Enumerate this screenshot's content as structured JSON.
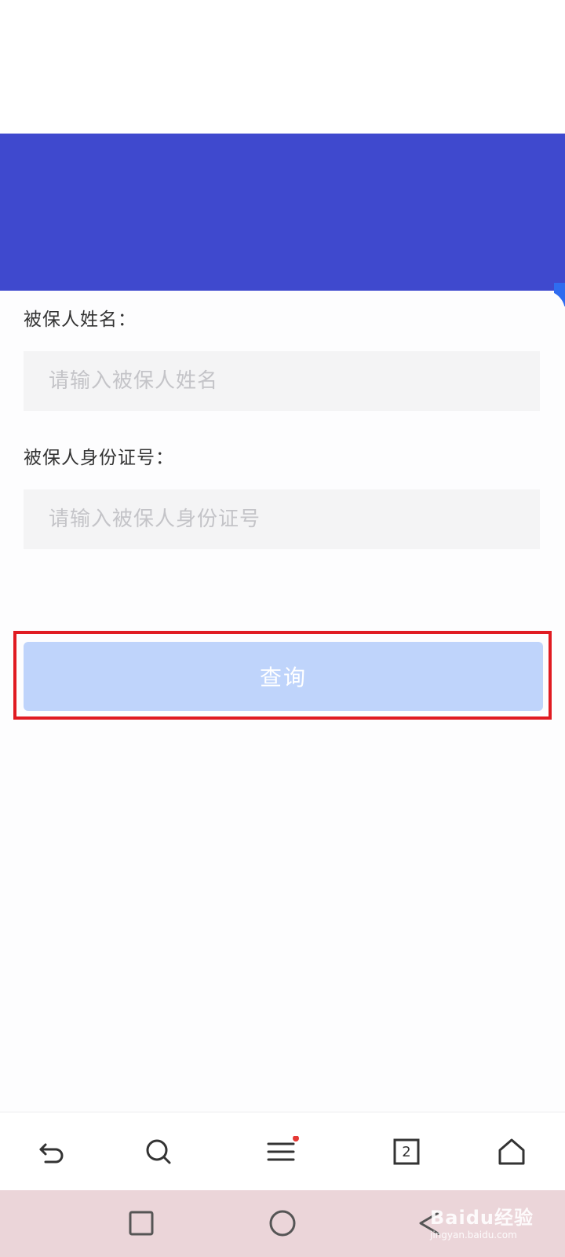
{
  "form": {
    "name_label": "被保人姓名：",
    "name_placeholder": "请输入被保人姓名",
    "name_value": "",
    "id_label": "被保人身份证号：",
    "id_placeholder": "请输入被保人身份证号",
    "id_value": "",
    "submit_label": "查询"
  },
  "toolbar": {
    "items": [
      {
        "icon": "back-arrow-icon"
      },
      {
        "icon": "search-icon"
      },
      {
        "icon": "menu-icon",
        "badge": true
      },
      {
        "icon": "tabs-icon",
        "count": "2"
      },
      {
        "icon": "home-icon"
      }
    ]
  },
  "system_nav": {
    "items": [
      {
        "icon": "recents-square-icon"
      },
      {
        "icon": "home-circle-icon"
      },
      {
        "icon": "back-triangle-icon"
      }
    ]
  },
  "watermark": {
    "logo": "Baidu经验",
    "url": "jingyan.baidu.com"
  },
  "colors": {
    "banner": "#3f49ce",
    "button": "#bfd4fb",
    "highlight": "#e01b22",
    "badge": "#e53935"
  }
}
